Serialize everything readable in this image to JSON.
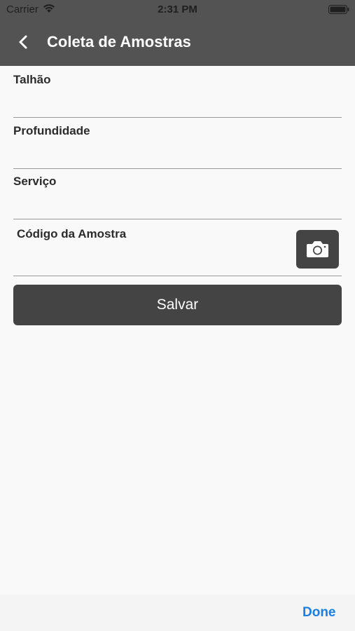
{
  "status_bar": {
    "carrier": "Carrier",
    "time": "2:31 PM",
    "wifi_icon": "wifi-icon",
    "battery_icon": "battery-icon"
  },
  "nav": {
    "back_icon": "chevron-left-icon",
    "title": "Coleta de Amostras"
  },
  "form": {
    "fields": [
      {
        "label": "Talhão",
        "value": ""
      },
      {
        "label": "Profundidade",
        "value": ""
      },
      {
        "label": "Serviço",
        "value": ""
      },
      {
        "label": "Código da Amostra",
        "value": ""
      }
    ],
    "camera_icon": "camera-icon",
    "save_label": "Salvar"
  },
  "keyboard_toolbar": {
    "done_label": "Done"
  },
  "colors": {
    "header": "#535353",
    "button": "#444444",
    "background": "#f9f9f9",
    "done": "#1b7fe2"
  }
}
